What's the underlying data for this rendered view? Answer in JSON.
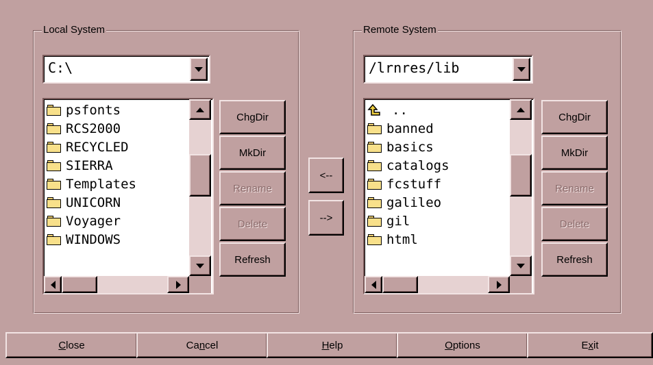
{
  "local": {
    "group_label": "Local System",
    "path": "C:\\",
    "items": [
      "psfonts",
      "RCS2000",
      "RECYCLED",
      "SIERRA",
      "Templates",
      "UNICORN",
      "Voyager",
      "WINDOWS"
    ],
    "buttons": {
      "chgdir": "ChgDir",
      "mkdir": "MkDir",
      "rename": "Rename",
      "delete": "Delete",
      "refresh": "Refresh"
    }
  },
  "remote": {
    "group_label": "Remote System",
    "path": "/lrnres/lib",
    "parent_item": "..",
    "items": [
      "banned",
      "basics",
      "catalogs",
      "fcstuff",
      "galileo",
      "gil",
      "html"
    ],
    "buttons": {
      "chgdir": "ChgDir",
      "mkdir": "MkDir",
      "rename": "Rename",
      "delete": "Delete",
      "refresh": "Refresh"
    }
  },
  "transfer": {
    "to_local": "<--",
    "to_remote": "-->"
  },
  "bottom": {
    "close": {
      "pre": "",
      "key": "C",
      "post": "lose"
    },
    "cancel": {
      "pre": "Ca",
      "key": "n",
      "post": "cel"
    },
    "help": {
      "pre": "",
      "key": "H",
      "post": "elp"
    },
    "options": {
      "pre": "",
      "key": "O",
      "post": "ptions"
    },
    "exit": {
      "pre": "E",
      "key": "x",
      "post": "it"
    }
  },
  "colors": {
    "background": "#c0a0a0",
    "scroll_track": "#e6d2d2",
    "folder": "#f8e08a"
  }
}
